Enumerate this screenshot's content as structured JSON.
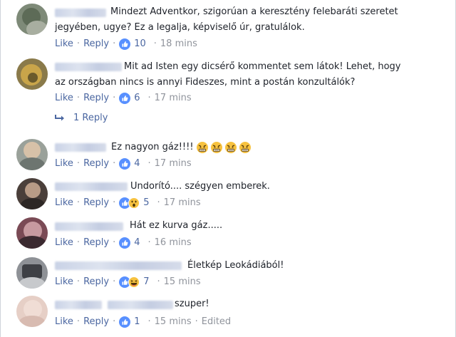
{
  "colors": {
    "link": "#4b67a1",
    "meta": "#90949c",
    "text": "#1d2129",
    "like_blue": "#5890ff"
  },
  "actions": {
    "like": "Like",
    "reply": "Reply",
    "separator": "·"
  },
  "comments": [
    {
      "text_lines": [
        "Mindezt Adventkor, szigorúan a keresztény felebaráti szeretet",
        "jegyében, ugye? Ez a legalja, képviselő úr, gratulálok."
      ],
      "reaction_icons": [
        "like-icon"
      ],
      "reaction_count": "10",
      "time": "18 mins",
      "edited": ""
    },
    {
      "text_lines": [
        "Mit ad Isten egy dicsérő kommentet sem látok! Lehet, hogy",
        "az országban nincs is annyi Fideszes, mint a postán konzultálók?"
      ],
      "reaction_icons": [
        "like-icon"
      ],
      "reaction_count": "6",
      "time": "17 mins",
      "edited": ""
    },
    {
      "text_lines": [
        "Ez nagyon gáz!!!! "
      ],
      "emojis": [
        "angry-face-icon",
        "angry-face-icon",
        "angry-face-icon",
        "angry-face-icon"
      ],
      "reaction_icons": [
        "like-icon"
      ],
      "reaction_count": "4",
      "time": "17 mins",
      "edited": ""
    },
    {
      "text_lines": [
        "Undorító.... szégyen emberek."
      ],
      "reaction_icons": [
        "like-icon",
        "wow-icon"
      ],
      "reaction_count": "5",
      "time": "17 mins",
      "edited": ""
    },
    {
      "text_lines": [
        "Hát ez kurva gáz....."
      ],
      "reaction_icons": [
        "like-icon"
      ],
      "reaction_count": "4",
      "time": "16 mins",
      "edited": ""
    },
    {
      "text_lines": [
        "Életkép Leokádiából!"
      ],
      "reaction_icons": [
        "like-icon",
        "haha-icon"
      ],
      "reaction_count": "7",
      "time": "15 mins",
      "edited": ""
    },
    {
      "text_lines": [
        "szuper!"
      ],
      "reaction_icons": [
        "like-icon"
      ],
      "reaction_count": "1",
      "time": "15 mins",
      "edited": "Edited"
    }
  ],
  "replies_link": {
    "label": "1 Reply",
    "icon": "reply-arrow-icon"
  }
}
